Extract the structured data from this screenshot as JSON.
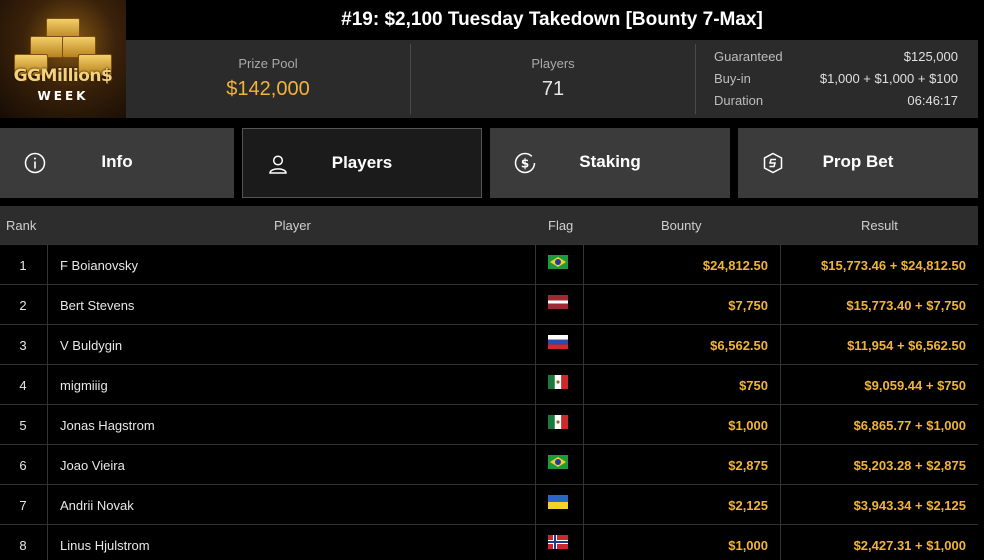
{
  "logo": {
    "line1": "GGMillion$",
    "line2": "WEEK"
  },
  "title": "#19: $2,100 Tuesday Takedown [Bounty 7-Max]",
  "stats": {
    "prize_pool_label": "Prize Pool",
    "prize_pool": "$142,000",
    "players_label": "Players",
    "players": "71"
  },
  "details": [
    {
      "label": "Guaranteed",
      "value": "$125,000"
    },
    {
      "label": "Buy-in",
      "value": "$1,000 + $1,000 + $100"
    },
    {
      "label": "Duration",
      "value": "06:46:17"
    }
  ],
  "tabs": [
    {
      "label": "Info",
      "icon": "info-icon"
    },
    {
      "label": "Players",
      "icon": "user-icon",
      "active": true
    },
    {
      "label": "Staking",
      "icon": "dollar-coin-icon"
    },
    {
      "label": "Prop Bet",
      "icon": "prop-bet-icon"
    }
  ],
  "table": {
    "headers": {
      "rank": "Rank",
      "player": "Player",
      "flag": "Flag",
      "bounty": "Bounty",
      "result": "Result"
    },
    "rows": [
      {
        "rank": "1",
        "player": "F Boianovsky",
        "flag": "brazil",
        "bounty": "$24,812.50",
        "result": "$15,773.46 + $24,812.50"
      },
      {
        "rank": "2",
        "player": "Bert Stevens",
        "flag": "latvia",
        "bounty": "$7,750",
        "result": "$15,773.40 + $7,750"
      },
      {
        "rank": "3",
        "player": "V Buldygin",
        "flag": "russia",
        "bounty": "$6,562.50",
        "result": "$11,954 + $6,562.50"
      },
      {
        "rank": "4",
        "player": "migmiiig",
        "flag": "mexico",
        "bounty": "$750",
        "result": "$9,059.44 + $750"
      },
      {
        "rank": "5",
        "player": "Jonas Hagstrom",
        "flag": "mexico",
        "bounty": "$1,000",
        "result": "$6,865.77 + $1,000"
      },
      {
        "rank": "6",
        "player": "Joao Vieira",
        "flag": "brazil",
        "bounty": "$2,875",
        "result": "$5,203.28 + $2,875"
      },
      {
        "rank": "7",
        "player": "Andrii Novak",
        "flag": "ukraine",
        "bounty": "$2,125",
        "result": "$3,943.34 + $2,125"
      },
      {
        "rank": "8",
        "player": "Linus Hjulstrom",
        "flag": "norway",
        "bounty": "$1,000",
        "result": "$2,427.31 + $1,000"
      }
    ]
  },
  "colors": {
    "accent": "#f0b43c",
    "panel": "#2b2b2b",
    "tab": "#3b3b3b",
    "tab_active": "#1b1b1b"
  }
}
